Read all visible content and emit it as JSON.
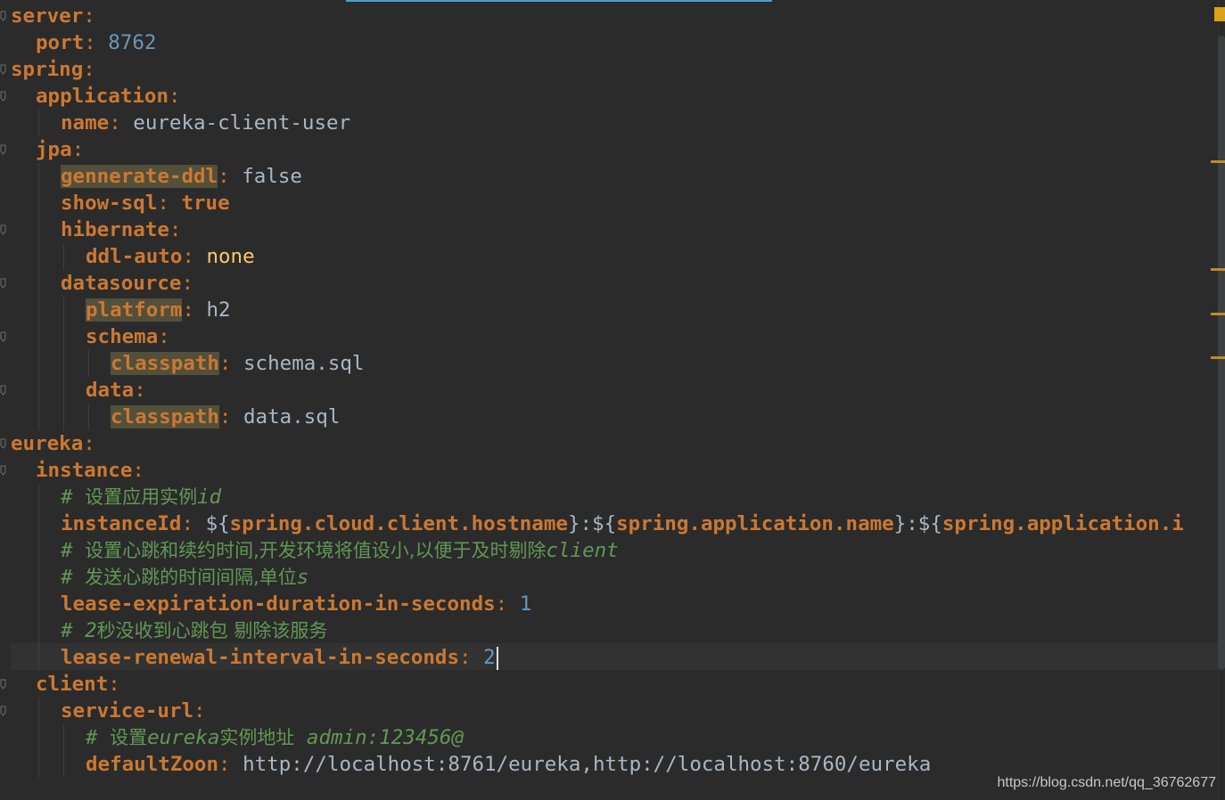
{
  "lines": [
    {
      "indent": 0,
      "parts": [
        {
          "t": "server",
          "c": "key"
        },
        {
          "t": ":",
          "c": "colon"
        }
      ]
    },
    {
      "indent": 1,
      "parts": [
        {
          "t": "port",
          "c": "key"
        },
        {
          "t": ": ",
          "c": "colon"
        },
        {
          "t": "8762",
          "c": "num"
        }
      ]
    },
    {
      "indent": 0,
      "parts": [
        {
          "t": "spring",
          "c": "key"
        },
        {
          "t": ":",
          "c": "colon"
        }
      ]
    },
    {
      "indent": 1,
      "parts": [
        {
          "t": "application",
          "c": "key"
        },
        {
          "t": ":",
          "c": "colon"
        }
      ]
    },
    {
      "indent": 2,
      "parts": [
        {
          "t": "name",
          "c": "key"
        },
        {
          "t": ": ",
          "c": "colon"
        },
        {
          "t": "eureka-client-user",
          "c": "val"
        }
      ]
    },
    {
      "indent": 1,
      "parts": [
        {
          "t": "jpa",
          "c": "key"
        },
        {
          "t": ":",
          "c": "colon"
        }
      ]
    },
    {
      "indent": 2,
      "parts": [
        {
          "t": "gennerate-ddl",
          "c": "key hl"
        },
        {
          "t": ": ",
          "c": "colon"
        },
        {
          "t": "false",
          "c": "val"
        }
      ]
    },
    {
      "indent": 2,
      "parts": [
        {
          "t": "show-sql",
          "c": "key"
        },
        {
          "t": ": ",
          "c": "colon"
        },
        {
          "t": "true",
          "c": "bool"
        }
      ]
    },
    {
      "indent": 2,
      "parts": [
        {
          "t": "hibernate",
          "c": "key"
        },
        {
          "t": ":",
          "c": "colon"
        }
      ]
    },
    {
      "indent": 3,
      "parts": [
        {
          "t": "ddl-auto",
          "c": "key"
        },
        {
          "t": ": ",
          "c": "colon"
        },
        {
          "t": "none",
          "c": "none"
        }
      ]
    },
    {
      "indent": 2,
      "parts": [
        {
          "t": "datasource",
          "c": "key"
        },
        {
          "t": ":",
          "c": "colon"
        }
      ]
    },
    {
      "indent": 3,
      "parts": [
        {
          "t": "platform",
          "c": "key hl"
        },
        {
          "t": ": ",
          "c": "colon"
        },
        {
          "t": "h2",
          "c": "val"
        }
      ]
    },
    {
      "indent": 3,
      "parts": [
        {
          "t": "schema",
          "c": "key"
        },
        {
          "t": ":",
          "c": "colon"
        }
      ]
    },
    {
      "indent": 4,
      "parts": [
        {
          "t": "classpath",
          "c": "key hl"
        },
        {
          "t": ": ",
          "c": "colon"
        },
        {
          "t": "schema.sql",
          "c": "val"
        }
      ]
    },
    {
      "indent": 3,
      "parts": [
        {
          "t": "data",
          "c": "key"
        },
        {
          "t": ":",
          "c": "colon"
        }
      ]
    },
    {
      "indent": 4,
      "parts": [
        {
          "t": "classpath",
          "c": "key hl"
        },
        {
          "t": ": ",
          "c": "colon"
        },
        {
          "t": "data.sql",
          "c": "val"
        }
      ]
    },
    {
      "indent": 0,
      "parts": [
        {
          "t": "eureka",
          "c": "key"
        },
        {
          "t": ":",
          "c": "colon"
        }
      ]
    },
    {
      "indent": 1,
      "parts": [
        {
          "t": "instance",
          "c": "key"
        },
        {
          "t": ":",
          "c": "colon"
        }
      ]
    },
    {
      "indent": 2,
      "parts": [
        {
          "t": "# ",
          "c": "comment"
        },
        {
          "t": "设置应用实例",
          "c": "comment cn"
        },
        {
          "t": "id",
          "c": "comment"
        }
      ]
    },
    {
      "indent": 2,
      "parts": [
        {
          "t": "instanceId",
          "c": "key"
        },
        {
          "t": ": ",
          "c": "colon"
        },
        {
          "t": "${",
          "c": "val"
        },
        {
          "t": "spring.cloud.client.hostname",
          "c": "key"
        },
        {
          "t": "}:${",
          "c": "val"
        },
        {
          "t": "spring.application.name",
          "c": "key"
        },
        {
          "t": "}:${",
          "c": "val"
        },
        {
          "t": "spring.application.i",
          "c": "key"
        }
      ]
    },
    {
      "indent": 2,
      "parts": [
        {
          "t": "# ",
          "c": "comment"
        },
        {
          "t": "设置心跳和续约时间,开发环境将值设小,以便于及时剔除",
          "c": "comment cn"
        },
        {
          "t": "client",
          "c": "comment"
        }
      ]
    },
    {
      "indent": 2,
      "parts": [
        {
          "t": "# ",
          "c": "comment"
        },
        {
          "t": "发送心跳的时间间隔,单位",
          "c": "comment cn"
        },
        {
          "t": "s",
          "c": "comment"
        }
      ]
    },
    {
      "indent": 2,
      "parts": [
        {
          "t": "lease-expiration-duration-in-seconds",
          "c": "key"
        },
        {
          "t": ": ",
          "c": "colon"
        },
        {
          "t": "1",
          "c": "num"
        }
      ]
    },
    {
      "indent": 2,
      "parts": [
        {
          "t": "# 2",
          "c": "comment"
        },
        {
          "t": "秒没收到心跳包 剔除该服务",
          "c": "comment cn"
        }
      ]
    },
    {
      "indent": 2,
      "caret": true,
      "parts": [
        {
          "t": "lease-renewal-interval-in-seconds",
          "c": "key"
        },
        {
          "t": ": ",
          "c": "colon"
        },
        {
          "t": "2",
          "c": "num"
        }
      ]
    },
    {
      "indent": 1,
      "parts": [
        {
          "t": "client",
          "c": "key"
        },
        {
          "t": ":",
          "c": "colon"
        }
      ]
    },
    {
      "indent": 2,
      "parts": [
        {
          "t": "service-url",
          "c": "key"
        },
        {
          "t": ":",
          "c": "colon"
        }
      ]
    },
    {
      "indent": 3,
      "parts": [
        {
          "t": "# ",
          "c": "comment"
        },
        {
          "t": "设置",
          "c": "comment cn"
        },
        {
          "t": "eureka",
          "c": "comment"
        },
        {
          "t": "实例地址",
          "c": "comment cn"
        },
        {
          "t": " admin:123456@",
          "c": "comment"
        }
      ]
    },
    {
      "indent": 3,
      "parts": [
        {
          "t": "defaultZoon",
          "c": "key"
        },
        {
          "t": ": ",
          "c": "colon"
        },
        {
          "t": "http://localhost:8761/eureka,http://localhost:8760/eureka",
          "c": "val"
        }
      ]
    }
  ],
  "watermark": "https://blog.csdn.net/qq_36762677",
  "colors": {
    "background": "#2b2b2b",
    "key": "#cc7832",
    "value": "#a9b7c6",
    "number": "#6897bb",
    "comment": "#629755",
    "none": "#ffc66d",
    "highlight": "#52503a"
  }
}
